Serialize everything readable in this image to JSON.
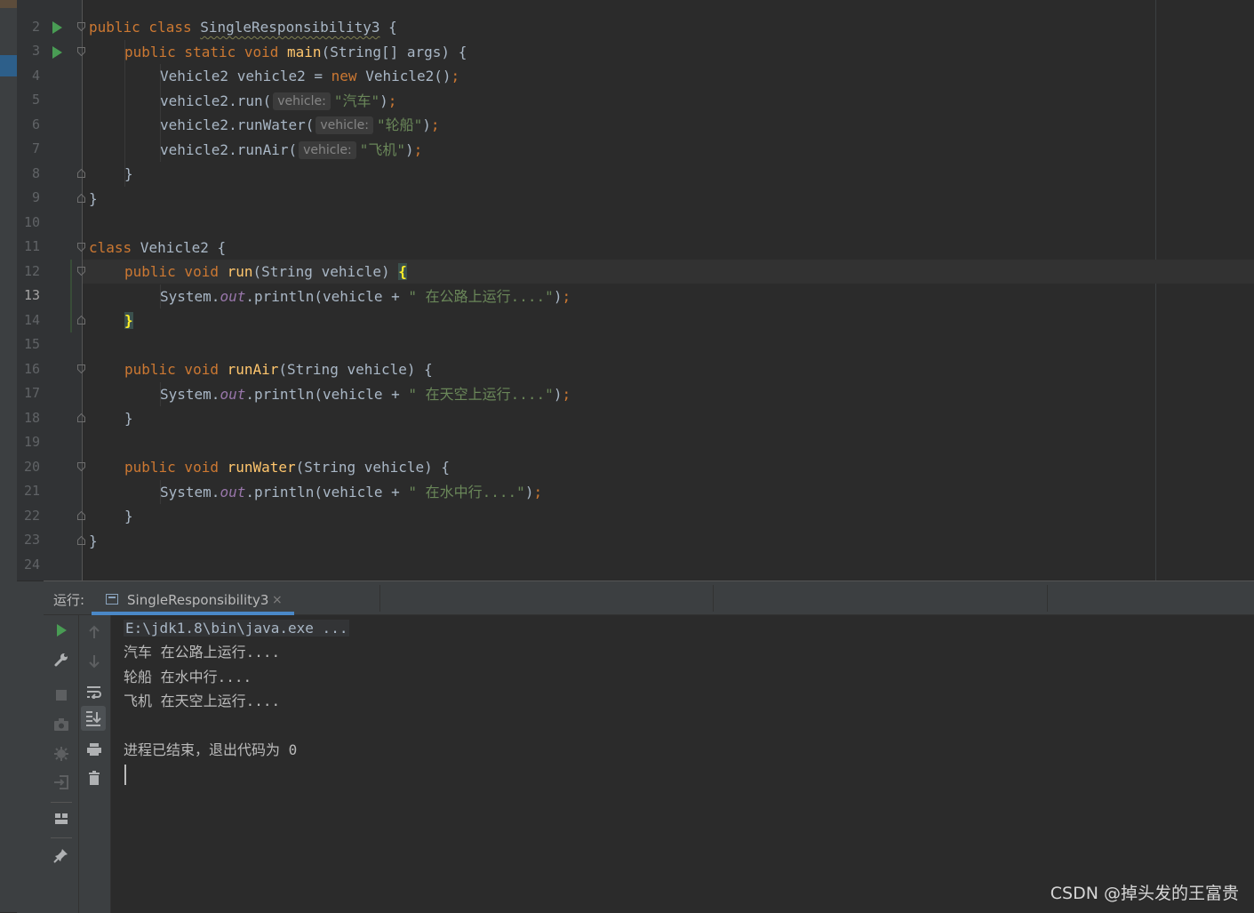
{
  "editor": {
    "lines": [
      {
        "num": "2"
      },
      {
        "num": "3",
        "t1": "public class ",
        "t2": "SingleResponsibility3",
        "t3": " {"
      },
      {
        "num": "4",
        "t1": "public static void ",
        "t2": "main",
        "t3": "(String[] args) {"
      },
      {
        "num": "5",
        "t1": "Vehicle2 vehicle2 = ",
        "t2": "new",
        "t3": " Vehicle2()",
        "t4": ";"
      },
      {
        "num": "6",
        "t1": "vehicle2.run(",
        "hint": "vehicle:",
        "t2": "\"汽车\"",
        "t3": ")",
        "t4": ";"
      },
      {
        "num": "7",
        "t1": "vehicle2.runWater(",
        "hint": "vehicle:",
        "t2": "\"轮船\"",
        "t3": ")",
        "t4": ";"
      },
      {
        "num": "8",
        "t1": "vehicle2.runAir(",
        "hint": "vehicle:",
        "t2": "\"飞机\"",
        "t3": ")",
        "t4": ";"
      },
      {
        "num": "9",
        "t1": "}"
      },
      {
        "num": "10",
        "t1": "}"
      },
      {
        "num": "11"
      },
      {
        "num": "12",
        "t1": "class",
        "t2": " Vehicle2 {"
      },
      {
        "num": "13",
        "t1": "public void ",
        "t2": "run",
        "t3": "(String vehicle) ",
        "t4": "{"
      },
      {
        "num": "14",
        "t1": "System.",
        "t2": "out",
        "t3": ".println(vehicle + ",
        "t4": "\" 在公路上运行....\"",
        "t5": ")",
        "t6": ";"
      },
      {
        "num": "15",
        "t1": "}"
      },
      {
        "num": "16"
      },
      {
        "num": "17",
        "t1": "public void ",
        "t2": "runAir",
        "t3": "(String vehicle) {"
      },
      {
        "num": "18",
        "t1": "System.",
        "t2": "out",
        "t3": ".println(vehicle + ",
        "t4": "\" 在天空上运行....\"",
        "t5": ")",
        "t6": ";"
      },
      {
        "num": "19",
        "t1": "}"
      },
      {
        "num": "20"
      },
      {
        "num": "21",
        "t1": "public void ",
        "t2": "runWater",
        "t3": "(String vehicle) {"
      },
      {
        "num": "22",
        "t1": "System.",
        "t2": "out",
        "t3": ".println(vehicle + ",
        "t4": "\" 在水中行....\"",
        "t5": ")",
        "t6": ";"
      },
      {
        "num": "23",
        "t1": "}"
      },
      {
        "num": "24",
        "t1": "}"
      }
    ]
  },
  "run_panel": {
    "label": "运行:",
    "tab_label": "SingleResponsibility3",
    "tab_close": "×",
    "console_lines": [
      "E:\\jdk1.8\\bin\\java.exe ...",
      "汽车 在公路上运行....",
      "轮船 在水中行....",
      "飞机 在天空上运行....",
      "",
      "进程已结束，退出代码为 0"
    ]
  },
  "watermark": "CSDN @掉头发的王富贵",
  "colors": {
    "background": "#2b2b2b",
    "keyword": "#cc7832",
    "function": "#ffc66d",
    "string": "#6a8759",
    "field": "#9876aa",
    "run_green": "#499c54",
    "accent_blue": "#4a88c7"
  }
}
